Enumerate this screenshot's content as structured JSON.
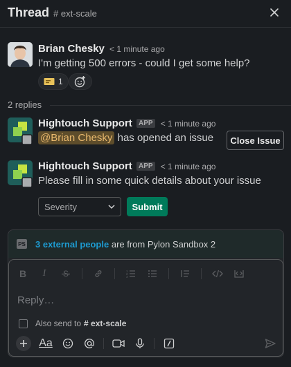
{
  "header": {
    "title": "Thread",
    "channel": "# ext-scale"
  },
  "parent_message": {
    "author": "Brian Chesky",
    "time": "< 1 minute ago",
    "text": "I'm getting 500 errors - could I get some help?",
    "reactions": [
      {
        "icon": "ticket-emoji",
        "count": "1"
      }
    ]
  },
  "replies_label": "2 replies",
  "reply1": {
    "author": "Hightouch Support",
    "badge": "APP",
    "time": "< 1 minute ago",
    "mention": "@Brian Chesky",
    "text": "has opened an issue",
    "button": "Close Issue"
  },
  "reply2": {
    "author": "Hightouch Support",
    "badge": "APP",
    "time": "< 1 minute ago",
    "text": "Please fill in some quick details about your issue",
    "select_value": "Severity",
    "submit": "Submit"
  },
  "external": {
    "badge": "PS",
    "link": "3 external people",
    "text": "are from Pylon Sandbox 2"
  },
  "composer": {
    "placeholder": "Reply…",
    "also_send": "Also send to",
    "also_send_channel": "# ext-scale",
    "aa_label": "Aa"
  },
  "colors": {
    "submit": "#007a5a",
    "mention_bg": "#5e4d2b",
    "link": "#1d9bd1"
  }
}
